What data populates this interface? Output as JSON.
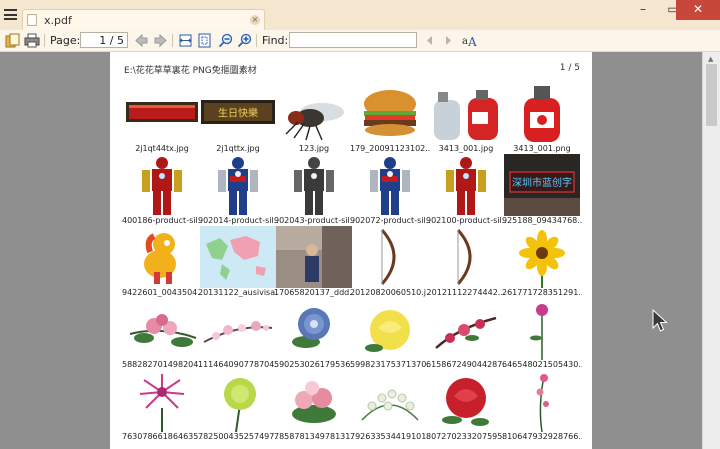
{
  "window": {
    "tab_title": "x.pdf",
    "tab_close": "×",
    "minimize": "–",
    "maximize": "▭",
    "close": "✕"
  },
  "toolbar": {
    "page_label": "Page:",
    "page_value": "1 / 5",
    "find_label": "Find:",
    "find_value": ""
  },
  "document": {
    "path": "E:\\花花草草裏花 PNG免摳圖素材",
    "page_indicator": "1 / 5",
    "items": [
      {
        "caption": "2j1qt44tx.jpg",
        "icon": "red-banner"
      },
      {
        "caption": "2j1qttx.jpg",
        "icon": "birthday-banner",
        "banner_text": "生日快樂"
      },
      {
        "caption": "123.jpg",
        "icon": "fly"
      },
      {
        "caption": "179_20091123102...",
        "icon": "burger"
      },
      {
        "caption": "3413_001.jpg",
        "icon": "gas-tanks"
      },
      {
        "caption": "3413_001.png",
        "icon": "gas-tank"
      },
      {
        "caption": "400186-product-sil...",
        "icon": "iron-man"
      },
      {
        "caption": "902014-product-sil...",
        "icon": "iron-patriot"
      },
      {
        "caption": "902043-product-sil...",
        "icon": "war-machine"
      },
      {
        "caption": "902072-product-sil...",
        "icon": "iron-patriot"
      },
      {
        "caption": "902100-product-sil...",
        "icon": "iron-man"
      },
      {
        "caption": "925188_09434768...",
        "icon": "neon-sign",
        "banner_text": "深圳市蓝创字"
      },
      {
        "caption": "9422601_0043504...",
        "icon": "cartoon-pony"
      },
      {
        "caption": "20131122_ausivisa...",
        "icon": "world-map"
      },
      {
        "caption": "17065820137_ddd...",
        "icon": "photo-person"
      },
      {
        "caption": "20120820060510.j...",
        "icon": "bow"
      },
      {
        "caption": "20121112274442...",
        "icon": "bow"
      },
      {
        "caption": "261771728351291...",
        "icon": "sunflower"
      },
      {
        "caption": "588282701498204...",
        "icon": "pink-flowers"
      },
      {
        "caption": "111464090778704...",
        "icon": "blossom-branch"
      },
      {
        "caption": "590253026179536...",
        "icon": "blue-flower"
      },
      {
        "caption": "599823175371370...",
        "icon": "yellow-rose"
      },
      {
        "caption": "615867249044287...",
        "icon": "plum-branch"
      },
      {
        "caption": "646548021505430...",
        "icon": "single-flower"
      },
      {
        "caption": "763078661864635...",
        "icon": "pink-chrysanthemum"
      },
      {
        "caption": "782500435257497...",
        "icon": "green-chrysanthemum"
      },
      {
        "caption": "785878134978131...",
        "icon": "rose-bouquet"
      },
      {
        "caption": "792633534419101...",
        "icon": "white-flowers"
      },
      {
        "caption": "807270233207595...",
        "icon": "red-rose"
      },
      {
        "caption": "810647932928766...",
        "icon": "pink-stem"
      }
    ]
  },
  "colors": {
    "chrome": "#f7ecd9",
    "viewer_bg": "#8f8f8f",
    "close_red": "#c7483a"
  }
}
